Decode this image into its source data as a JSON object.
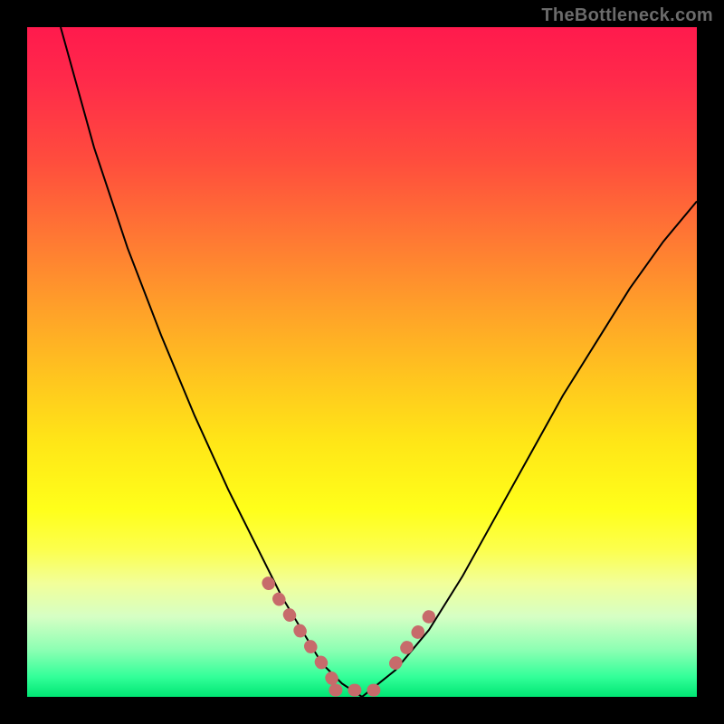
{
  "watermark": "TheBottleneck.com",
  "chart_data": {
    "type": "line",
    "title": "",
    "xlabel": "",
    "ylabel": "",
    "xlim": [
      0,
      100
    ],
    "ylim": [
      0,
      100
    ],
    "grid": false,
    "series": [
      {
        "name": "curve",
        "x": [
          5,
          10,
          15,
          20,
          25,
          30,
          35,
          38,
          41,
          44,
          47,
          50,
          55,
          60,
          65,
          70,
          75,
          80,
          85,
          90,
          95,
          100
        ],
        "y": [
          100,
          82,
          67,
          54,
          42,
          31,
          21,
          15,
          10,
          5,
          2,
          0,
          4,
          10,
          18,
          27,
          36,
          45,
          53,
          61,
          68,
          74
        ]
      }
    ],
    "highlight_segments": [
      {
        "name": "left-slope",
        "x": [
          36,
          46
        ],
        "y": [
          17,
          2
        ]
      },
      {
        "name": "trough",
        "x": [
          46,
          53
        ],
        "y": [
          1,
          1
        ]
      },
      {
        "name": "right-slope",
        "x": [
          55,
          60
        ],
        "y": [
          5,
          12
        ]
      }
    ],
    "background_gradient": {
      "top": "#ff1a4d",
      "mid": "#ffe617",
      "bottom": "#00e673"
    }
  }
}
